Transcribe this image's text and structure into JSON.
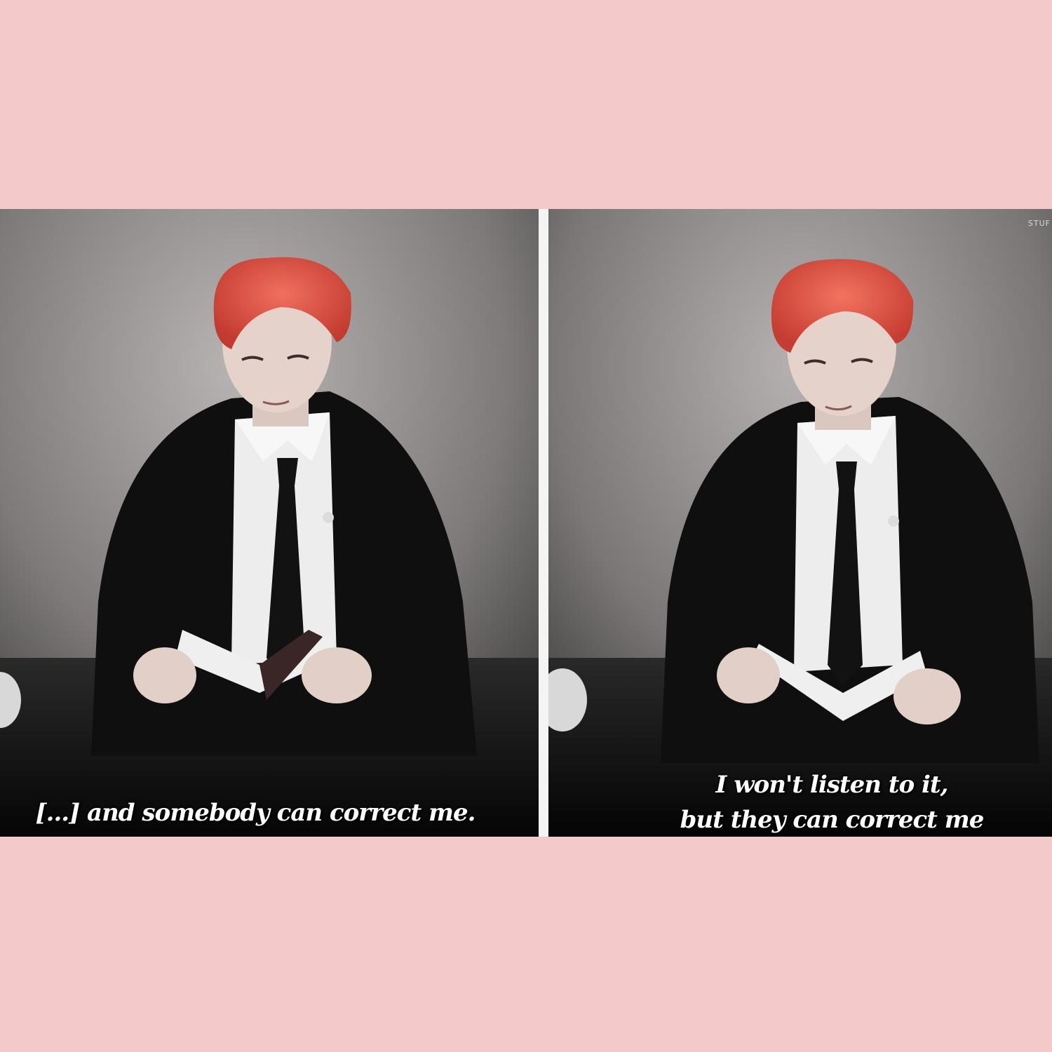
{
  "background_color": "#f3c9ca",
  "panels": [
    {
      "caption_lines": [
        "[...] and somebody can correct me."
      ]
    },
    {
      "caption_lines": [
        "I won't listen to it,",
        "but they can correct me"
      ],
      "watermark": "STUF"
    }
  ]
}
